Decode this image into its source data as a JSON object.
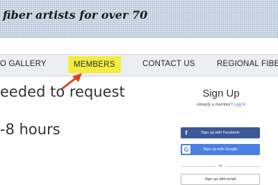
{
  "banner": {
    "tagline": "fiber artists for over 70"
  },
  "nav": {
    "items": [
      {
        "label": "O GALLERY"
      },
      {
        "label": "MEMBERS"
      },
      {
        "label": "CONTACT US"
      },
      {
        "label": "REGIONAL FIBER"
      }
    ],
    "highlight_color": "#f4ec3c"
  },
  "content": {
    "line1": "eeded to request",
    "line2": "-8 hours"
  },
  "signup": {
    "title": "Sign Up",
    "already_member": "Already a member?",
    "login_link": "Log In",
    "facebook_button": "Sign up with Facebook",
    "facebook_icon": "f",
    "google_button": "Sign up with Google",
    "google_icon": "G",
    "divider": "or",
    "email_button": "Sign up with email",
    "colors": {
      "facebook": "#3b5998",
      "google": "#4a7fe3",
      "link": "#2f6fd6"
    }
  },
  "annotation": {
    "arrow_color": "#e0401c"
  }
}
